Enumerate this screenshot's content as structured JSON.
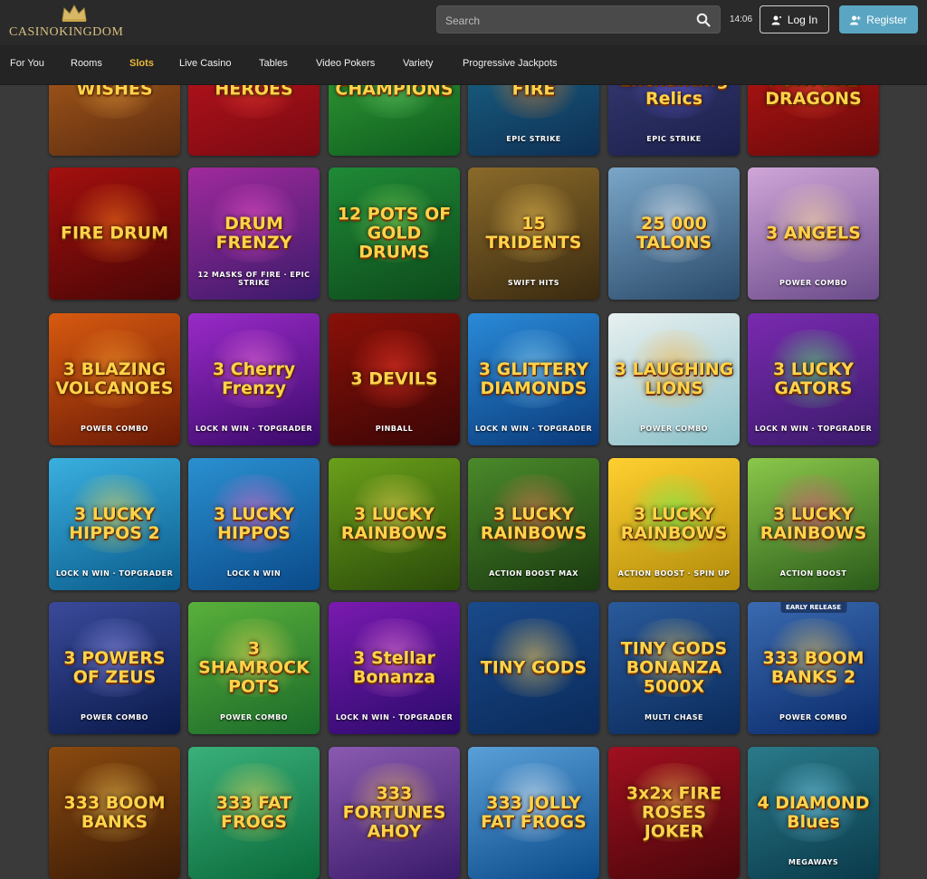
{
  "header": {
    "logo_text": "CASINOKINGDOM",
    "search_placeholder": "Search",
    "time": "14:06",
    "login_label": "Log In",
    "register_label": "Register"
  },
  "nav": {
    "items": [
      {
        "label": "For You",
        "active": false
      },
      {
        "label": "Rooms",
        "active": false
      },
      {
        "label": "Slots",
        "active": true
      },
      {
        "label": "Live Casino",
        "active": false
      },
      {
        "label": "Tables",
        "active": false
      },
      {
        "label": "Video Pokers",
        "active": false
      },
      {
        "label": "Variety",
        "active": false
      },
      {
        "label": "Progressive Jackpots",
        "active": false
      }
    ]
  },
  "colors": {
    "accent_active": "#e9b83a",
    "register_button": "#5aa6c2",
    "background": "#3a3a3a",
    "header_bg": "#2a2a2a"
  },
  "games": {
    "rows": [
      [
        {
          "title": "WISHES",
          "subtitle": "",
          "badge": "",
          "bg": [
            "#5a2b10",
            "#b8631c"
          ],
          "glow": "#ffb347"
        },
        {
          "title": "HEROES",
          "subtitle": "",
          "badge": "",
          "bg": [
            "#7a0a12",
            "#c3141e"
          ],
          "glow": "#ff4a3d"
        },
        {
          "title": "CHAMPIONS",
          "subtitle": "",
          "badge": "",
          "bg": [
            "#0d5c1e",
            "#3aa83a"
          ],
          "glow": "#7ee07e"
        },
        {
          "title": "FIRE",
          "subtitle": "EPIC STRIKE",
          "badge": "",
          "bg": [
            "#0e2f55",
            "#1b6c8a"
          ],
          "glow": "#ff8a2a"
        },
        {
          "title": "Enchanting Relics",
          "subtitle": "EPIC STRIKE",
          "badge": "",
          "bg": [
            "#1a1f4a",
            "#3b3f7a"
          ],
          "glow": "#7a6cff"
        },
        {
          "title": "FORTUNE DRAGONS",
          "subtitle": "",
          "badge": "",
          "bg": [
            "#6a0a0a",
            "#c01616"
          ],
          "glow": "#ff5a3a"
        }
      ],
      [
        {
          "title": "FIRE DRUM",
          "subtitle": "",
          "badge": "",
          "bg": [
            "#4a0606",
            "#a3100e"
          ],
          "glow": "#ff7a1a"
        },
        {
          "title": "DRUM FRENZY",
          "subtitle": "12 MASKS OF FIRE · EPIC STRIKE",
          "badge": "",
          "bg": [
            "#3a1a6a",
            "#a02a9c"
          ],
          "glow": "#ff5ad6"
        },
        {
          "title": "12 POTS OF GOLD DRUMS",
          "subtitle": "",
          "badge": "",
          "bg": [
            "#0d4a1c",
            "#1f8a36"
          ],
          "glow": "#8ee05a"
        },
        {
          "title": "15 TRIDENTS",
          "subtitle": "SWIFT HITS",
          "badge": "",
          "bg": [
            "#3a2a10",
            "#8a6a2a"
          ],
          "glow": "#ffd05a"
        },
        {
          "title": "25 000 TALONS",
          "subtitle": "",
          "badge": "",
          "bg": [
            "#2a4a6a",
            "#7aa6c8"
          ],
          "glow": "#ffffff"
        },
        {
          "title": "3 ANGELS",
          "subtitle": "POWER COMBO",
          "badge": "",
          "bg": [
            "#6a4a8a",
            "#d0a6d8"
          ],
          "glow": "#ffe0a0"
        }
      ],
      [
        {
          "title": "3 BLAZING VOLCANOES",
          "subtitle": "POWER COMBO",
          "badge": "",
          "bg": [
            "#6a1a06",
            "#d85a10"
          ],
          "glow": "#ffa030"
        },
        {
          "title": "3 Cherry Frenzy",
          "subtitle": "LOCK N WIN · TOPGRADER",
          "badge": "",
          "bg": [
            "#3a0a6a",
            "#9a2ac8"
          ],
          "glow": "#ff7ae0"
        },
        {
          "title": "3 DEVILS",
          "subtitle": "PINBALL",
          "badge": "",
          "bg": [
            "#3a0606",
            "#8a1008"
          ],
          "glow": "#ff3a2a"
        },
        {
          "title": "3 GLITTERY DIAMONDS",
          "subtitle": "LOCK N WIN · TOPGRADER",
          "badge": "",
          "bg": [
            "#0a3a7a",
            "#2a8ad8"
          ],
          "glow": "#9ae0ff"
        },
        {
          "title": "3 LAUGHING LIONS",
          "subtitle": "POWER COMBO",
          "badge": "",
          "bg": [
            "#8ac0c8",
            "#e8f0f0"
          ],
          "glow": "#ffb030"
        },
        {
          "title": "3 LUCKY GATORS",
          "subtitle": "LOCK N WIN · TOPGRADER",
          "badge": "",
          "bg": [
            "#3a1a6a",
            "#7a2ab0"
          ],
          "glow": "#5aff6a"
        }
      ],
      [
        {
          "title": "3 LUCKY HIPPOS 2",
          "subtitle": "LOCK N WIN · TOPGRADER",
          "badge": "",
          "bg": [
            "#0a5a8a",
            "#3ab0e0"
          ],
          "glow": "#ffe04a"
        },
        {
          "title": "3 LUCKY HIPPOS",
          "subtitle": "LOCK N WIN",
          "badge": "",
          "bg": [
            "#0a4a8a",
            "#2a90d0"
          ],
          "glow": "#ff6ad0"
        },
        {
          "title": "3 LUCKY RAINBOWS",
          "subtitle": "",
          "badge": "",
          "bg": [
            "#2a4a0a",
            "#6aa01a"
          ],
          "glow": "#ffe05a"
        },
        {
          "title": "3 LUCKY RAINBOWS",
          "subtitle": "ACTION BOOST MAX",
          "badge": "",
          "bg": [
            "#1a3a10",
            "#4a8a2a"
          ],
          "glow": "#ff7a5a"
        },
        {
          "title": "3 LUCKY RAINBOWS",
          "subtitle": "ACTION BOOST · SPIN UP",
          "badge": "",
          "bg": [
            "#b08a0a",
            "#ffd030"
          ],
          "glow": "#5aff5a"
        },
        {
          "title": "3 LUCKY RAINBOWS",
          "subtitle": "ACTION BOOST",
          "badge": "",
          "bg": [
            "#2a5a1a",
            "#8ac84a"
          ],
          "glow": "#ff4a8a"
        }
      ],
      [
        {
          "title": "3 POWERS OF ZEUS",
          "subtitle": "POWER COMBO",
          "badge": "",
          "bg": [
            "#0a1a4a",
            "#3a4a9a"
          ],
          "glow": "#a0a0ff"
        },
        {
          "title": "3 SHAMROCK POTS",
          "subtitle": "POWER COMBO",
          "badge": "",
          "bg": [
            "#1a6a2a",
            "#5ab03a"
          ],
          "glow": "#ffe05a"
        },
        {
          "title": "3 Stellar Bonanza",
          "subtitle": "LOCK N WIN · TOPGRADER",
          "badge": "",
          "bg": [
            "#2a0a6a",
            "#7a1ab0"
          ],
          "glow": "#ff8ae0"
        },
        {
          "title": "TINY GODS",
          "subtitle": "",
          "badge": "",
          "bg": [
            "#0a2a5a",
            "#1a4a8a"
          ],
          "glow": "#ffd05a"
        },
        {
          "title": "TINY GODS BONANZA 5000X",
          "subtitle": "MULTI CHASE",
          "badge": "",
          "bg": [
            "#0a2a5a",
            "#2a5a9a"
          ],
          "glow": "#ffd05a"
        },
        {
          "title": "333 BOOM BANKS 2",
          "subtitle": "POWER COMBO",
          "badge": "EARLY RELEASE",
          "bg": [
            "#0a2a6a",
            "#3a6ab0"
          ],
          "glow": "#ffd05a"
        }
      ],
      [
        {
          "title": "333 BOOM BANKS",
          "subtitle": "",
          "badge": "",
          "bg": [
            "#3a1a06",
            "#8a4a10"
          ],
          "glow": "#ffd05a"
        },
        {
          "title": "333 FAT FROGS",
          "subtitle": "",
          "badge": "",
          "bg": [
            "#0a6a3a",
            "#3ab07a"
          ],
          "glow": "#ffe05a"
        },
        {
          "title": "333 FORTUNES AHOY",
          "subtitle": "",
          "badge": "",
          "bg": [
            "#3a1a6a",
            "#8a5ab0"
          ],
          "glow": "#ffd05a"
        },
        {
          "title": "333 JOLLY FAT FROGS",
          "subtitle": "",
          "badge": "",
          "bg": [
            "#0a4a8a",
            "#5aa0d8"
          ],
          "glow": "#ffffff"
        },
        {
          "title": "3x2x FIRE ROSES JOKER",
          "subtitle": "",
          "badge": "",
          "bg": [
            "#4a060a",
            "#a01020"
          ],
          "glow": "#ffd05a"
        },
        {
          "title": "4 DIAMOND Blues",
          "subtitle": "MEGAWAYS",
          "badge": "",
          "bg": [
            "#0a3a4a",
            "#2a7a8a"
          ],
          "glow": "#8ae0ff"
        }
      ]
    ]
  }
}
